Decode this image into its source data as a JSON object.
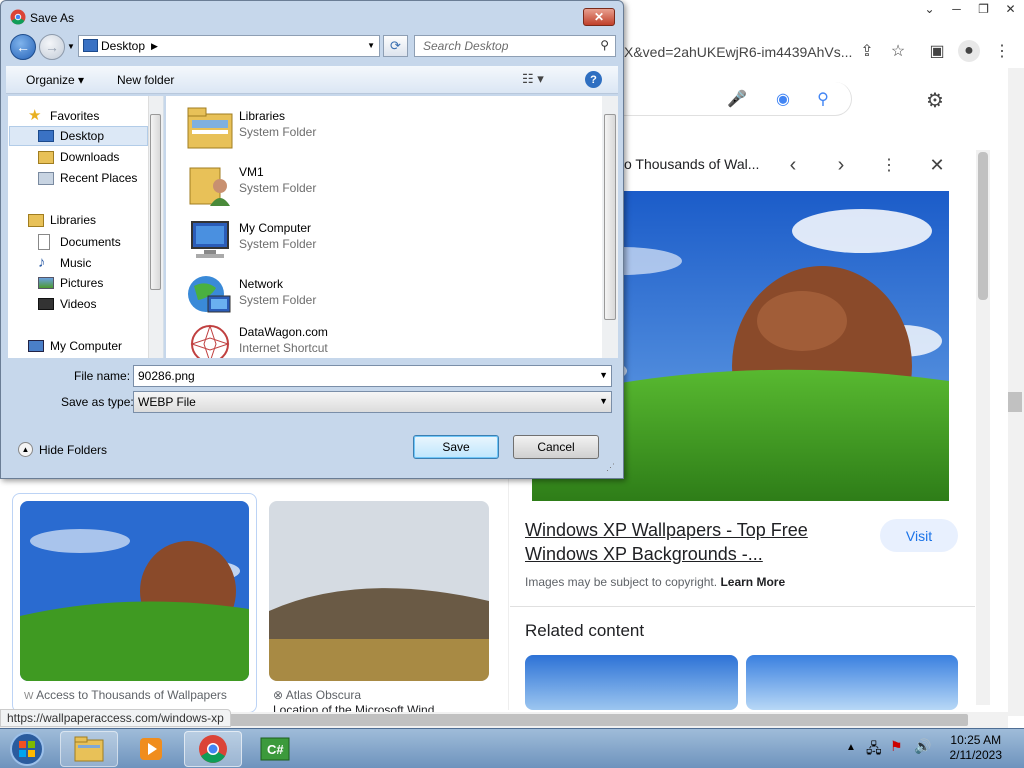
{
  "browser": {
    "url_fragment": "X&ved=2ahUKEwjR6-im4439AhVs...",
    "panel_title": "o Thousands of Wal...",
    "result_title": "Windows XP Wallpapers - Top Free Windows XP Backgrounds -...",
    "visit_label": "Visit",
    "copyright_text": "Images may be subject to copyright.",
    "learn_more": "Learn More",
    "related_heading": "Related content",
    "status_url": "https://wallpaperaccess.com/windows-xp",
    "results": [
      {
        "caption": "Access to Thousands of Wallpapers",
        "icon": "W"
      },
      {
        "caption": "Atlas Obscura",
        "subtitle": "Location of the Microsoft Wind..."
      }
    ]
  },
  "dialog": {
    "title": "Save As",
    "close_label": "✕",
    "address": "Desktop",
    "search_placeholder": "Search Desktop",
    "organize_label": "Organize ▾",
    "new_folder_label": "New folder",
    "nav": {
      "favorites": "Favorites",
      "desktop": "Desktop",
      "downloads": "Downloads",
      "recent_places": "Recent Places",
      "libraries": "Libraries",
      "documents": "Documents",
      "music": "Music",
      "pictures": "Pictures",
      "videos": "Videos",
      "my_computer": "My Computer"
    },
    "files": [
      {
        "name": "Libraries",
        "type": "System Folder",
        "icon": "libraries-icon"
      },
      {
        "name": "VM1",
        "type": "System Folder",
        "icon": "user-folder-icon"
      },
      {
        "name": "My Computer",
        "type": "System Folder",
        "icon": "computer-icon"
      },
      {
        "name": "Network",
        "type": "System Folder",
        "icon": "network-icon"
      },
      {
        "name": "DataWagon.com",
        "type": "Internet Shortcut",
        "icon": "shortcut-icon"
      }
    ],
    "file_name_label": "File name:",
    "file_name_value": "90286.png",
    "save_type_label": "Save as type:",
    "save_type_value": "WEBP File",
    "hide_folders_label": "Hide Folders",
    "save_label": "Save",
    "cancel_label": "Cancel"
  },
  "taskbar": {
    "time": "10:25 AM",
    "date": "2/11/2023",
    "apps": [
      "start-orb-icon",
      "explorer-icon",
      "media-player-icon",
      "chrome-icon",
      "csharp-icon"
    ]
  }
}
